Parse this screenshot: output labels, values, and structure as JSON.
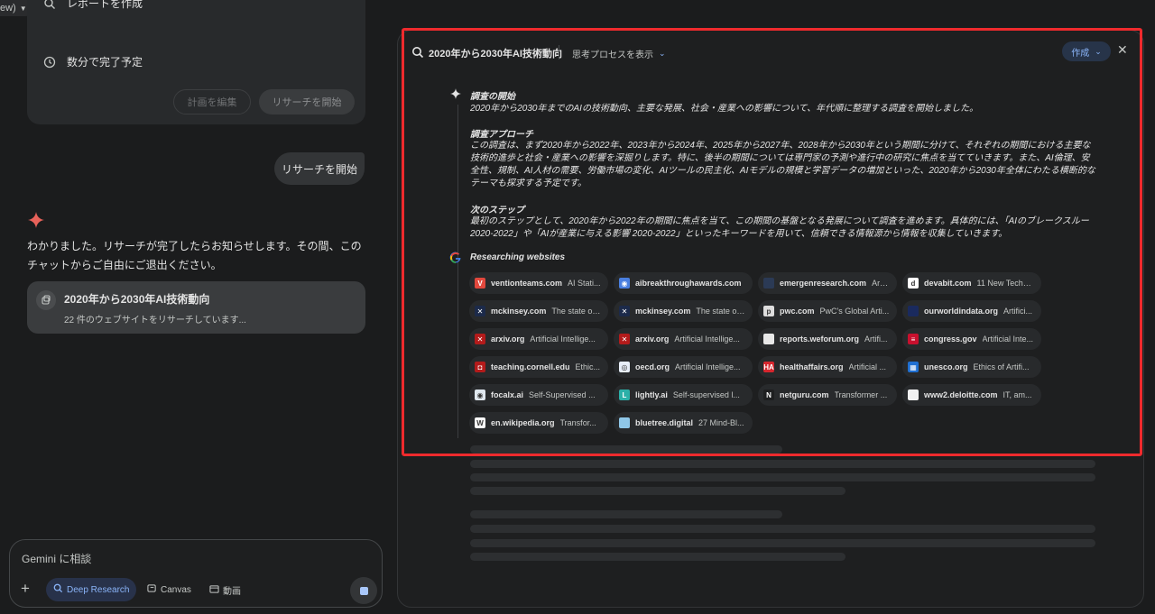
{
  "model_chip": {
    "label": "ew)"
  },
  "plan": {
    "row1_label": "レポートを作成",
    "row2_label": "数分で完了予定",
    "edit_button": "計画を編集",
    "start_button": "リサーチを開始"
  },
  "user_message": "リサーチを開始",
  "assistant_reply": "わかりました。リサーチが完了したらお知らせします。その間、このチャットからご自由にご退出ください。",
  "research_card": {
    "title": "2020年から2030年AI技術動向",
    "subtitle": "22 件のウェブサイトをリサーチしています..."
  },
  "composer": {
    "placeholder": "Gemini に相談",
    "deep_research": "Deep Research",
    "canvas": "Canvas",
    "video": "動画"
  },
  "panel": {
    "title": "2020年から2030年AI技術動向",
    "thinking_toggle": "思考プロセスを表示",
    "create_button": "作成",
    "sections": [
      {
        "heading": "調査の開始",
        "body": "2020年から2030年までのAIの技術動向、主要な発展、社会・産業への影響について、年代順に整理する調査を開始しました。"
      },
      {
        "heading": "調査アプローチ",
        "body": "この調査は、まず2020年から2022年、2023年から2024年、2025年から2027年、2028年から2030年という期間に分けて、それぞれの期間における主要な技術的進歩と社会・産業への影響を深掘りします。特に、後半の期間については専門家の予測や進行中の研究に焦点を当てていきます。また、AI倫理、安全性、規制、AI人材の需要、労働市場の変化、AIツールの民主化、AIモデルの規模と学習データの増加といった、2020年から2030年全体にわたる横断的なテーマも探求する予定です。"
      },
      {
        "heading": "次のステップ",
        "body": "最初のステップとして、2020年から2022年の期間に焦点を当て、この期間の基盤となる発展について調査を進めます。具体的には、「AIのブレークスルー 2020-2022」や「AIが産業に与える影響 2020-2022」といったキーワードを用いて、信頼できる情報源から情報を収集していきます。"
      }
    ],
    "researching_label": "Researching websites",
    "sites": [
      {
        "domain": "ventionteams.com",
        "title": "AI Stati...",
        "color": "#e2483d",
        "glyph": "V"
      },
      {
        "domain": "aibreakthroughawards.com",
        "title": "...",
        "color": "#4a7fe0",
        "glyph": "◉"
      },
      {
        "domain": "emergenresearch.com",
        "title": "Arti...",
        "color": "#2b3a55",
        "glyph": ""
      },
      {
        "domain": "devabit.com",
        "title": "11 New Techn...",
        "color": "#ffffff",
        "glyph": "d"
      },
      {
        "domain": "mckinsey.com",
        "title": "The state of...",
        "color": "#1c2a4a",
        "glyph": "✕"
      },
      {
        "domain": "mckinsey.com",
        "title": "The state of...",
        "color": "#1c2a4a",
        "glyph": "✕"
      },
      {
        "domain": "pwc.com",
        "title": "PwC's Global Arti...",
        "color": "#dddddd",
        "glyph": "p"
      },
      {
        "domain": "ourworldindata.org",
        "title": "Artifici...",
        "color": "#1a2a5e",
        "glyph": ""
      },
      {
        "domain": "arxiv.org",
        "title": "Artificial Intellige...",
        "color": "#b31b1b",
        "glyph": "✕"
      },
      {
        "domain": "arxiv.org",
        "title": "Artificial Intellige...",
        "color": "#b31b1b",
        "glyph": "✕"
      },
      {
        "domain": "reports.weforum.org",
        "title": "Artifi...",
        "color": "#e8e8e8",
        "glyph": ""
      },
      {
        "domain": "congress.gov",
        "title": "Artificial Inte...",
        "color": "#c8102e",
        "glyph": "≡"
      },
      {
        "domain": "teaching.cornell.edu",
        "title": "Ethic...",
        "color": "#b31b1b",
        "glyph": "◘"
      },
      {
        "domain": "oecd.org",
        "title": "Artificial Intellige...",
        "color": "#e8eef8",
        "glyph": "◎"
      },
      {
        "domain": "healthaffairs.org",
        "title": "Artificial ...",
        "color": "#d7262e",
        "glyph": "HA"
      },
      {
        "domain": "unesco.org",
        "title": "Ethics of Artifi...",
        "color": "#1f6fd1",
        "glyph": "▦"
      },
      {
        "domain": "focalx.ai",
        "title": "Self-Supervised ...",
        "color": "#dfe7ee",
        "glyph": "◉"
      },
      {
        "domain": "lightly.ai",
        "title": "Self-supervised l...",
        "color": "#2bb0a8",
        "glyph": "L"
      },
      {
        "domain": "netguru.com",
        "title": "Transformer ...",
        "color": "#1e1f20",
        "glyph": "N"
      },
      {
        "domain": "www2.deloitte.com",
        "title": "IT, am...",
        "color": "#f2f2f2",
        "glyph": ""
      },
      {
        "domain": "en.wikipedia.org",
        "title": "Transfor...",
        "color": "#f8f8f8",
        "glyph": "W"
      },
      {
        "domain": "bluetree.digital",
        "title": "27 Mind-Bl...",
        "color": "#8fc7e8",
        "glyph": ""
      }
    ]
  },
  "colors": {
    "accent": "#8ab4f8",
    "highlight_border": "#ef2a2d",
    "background": "#1b1c1d",
    "panel": "#1e1f20"
  }
}
